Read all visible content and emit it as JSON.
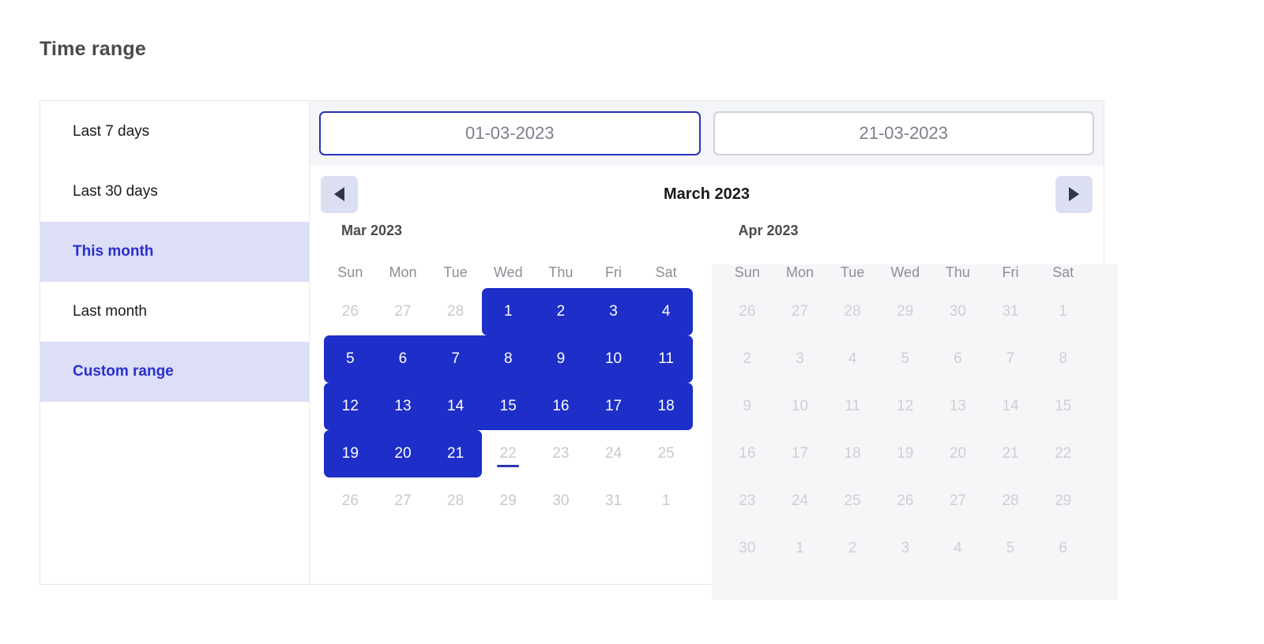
{
  "page": {
    "title": "Time range"
  },
  "sidebar": {
    "presets": [
      {
        "label": "Last 7 days",
        "active": false
      },
      {
        "label": "Last 30 days",
        "active": false
      },
      {
        "label": "This month",
        "active": true
      },
      {
        "label": "Last month",
        "active": false
      },
      {
        "label": "Custom range",
        "active": true
      }
    ]
  },
  "inputs": {
    "start": {
      "value": "01-03-2023",
      "focused": true
    },
    "end": {
      "value": "21-03-2023",
      "focused": false
    }
  },
  "nav": {
    "prev_icon": "triangle-left-icon",
    "next_icon": "triangle-right-icon",
    "title": "March 2023"
  },
  "colors": {
    "selection": "#1d2ec9",
    "accent": "#2a2fd0",
    "highlight_bg": "#dcdff5",
    "nav_btn_bg": "#dcdff2",
    "disabled_panel": "#f6f6f8"
  },
  "weekdays": [
    "Sun",
    "Mon",
    "Tue",
    "Wed",
    "Thu",
    "Fri",
    "Sat"
  ],
  "months": [
    {
      "label": "Mar 2023",
      "disabled": false,
      "weeks": [
        [
          {
            "d": "26",
            "state": "muted"
          },
          {
            "d": "27",
            "state": "muted"
          },
          {
            "d": "28",
            "state": "muted"
          },
          {
            "d": "1",
            "state": "sel",
            "edge": "start"
          },
          {
            "d": "2",
            "state": "sel"
          },
          {
            "d": "3",
            "state": "sel"
          },
          {
            "d": "4",
            "state": "sel",
            "edge": "end"
          }
        ],
        [
          {
            "d": "5",
            "state": "sel",
            "edge": "start"
          },
          {
            "d": "6",
            "state": "sel"
          },
          {
            "d": "7",
            "state": "sel"
          },
          {
            "d": "8",
            "state": "sel"
          },
          {
            "d": "9",
            "state": "sel"
          },
          {
            "d": "10",
            "state": "sel"
          },
          {
            "d": "11",
            "state": "sel",
            "edge": "end"
          }
        ],
        [
          {
            "d": "12",
            "state": "sel",
            "edge": "start"
          },
          {
            "d": "13",
            "state": "sel"
          },
          {
            "d": "14",
            "state": "sel"
          },
          {
            "d": "15",
            "state": "sel"
          },
          {
            "d": "16",
            "state": "sel"
          },
          {
            "d": "17",
            "state": "sel"
          },
          {
            "d": "18",
            "state": "sel",
            "edge": "end"
          }
        ],
        [
          {
            "d": "19",
            "state": "sel",
            "edge": "start"
          },
          {
            "d": "20",
            "state": "sel"
          },
          {
            "d": "21",
            "state": "sel",
            "edge": "end"
          },
          {
            "d": "22",
            "state": "muted",
            "today": true
          },
          {
            "d": "23",
            "state": "muted"
          },
          {
            "d": "24",
            "state": "muted"
          },
          {
            "d": "25",
            "state": "muted"
          }
        ],
        [
          {
            "d": "26",
            "state": "muted"
          },
          {
            "d": "27",
            "state": "muted"
          },
          {
            "d": "28",
            "state": "muted"
          },
          {
            "d": "29",
            "state": "muted"
          },
          {
            "d": "30",
            "state": "muted"
          },
          {
            "d": "31",
            "state": "muted"
          },
          {
            "d": "1",
            "state": "muted"
          }
        ]
      ]
    },
    {
      "label": "Apr 2023",
      "disabled": true,
      "weeks": [
        [
          {
            "d": "26",
            "state": "off"
          },
          {
            "d": "27",
            "state": "off"
          },
          {
            "d": "28",
            "state": "off"
          },
          {
            "d": "29",
            "state": "off"
          },
          {
            "d": "30",
            "state": "off"
          },
          {
            "d": "31",
            "state": "off"
          },
          {
            "d": "1",
            "state": "off"
          }
        ],
        [
          {
            "d": "2",
            "state": "off"
          },
          {
            "d": "3",
            "state": "off"
          },
          {
            "d": "4",
            "state": "off"
          },
          {
            "d": "5",
            "state": "off"
          },
          {
            "d": "6",
            "state": "off"
          },
          {
            "d": "7",
            "state": "off"
          },
          {
            "d": "8",
            "state": "off"
          }
        ],
        [
          {
            "d": "9",
            "state": "off"
          },
          {
            "d": "10",
            "state": "off"
          },
          {
            "d": "11",
            "state": "off"
          },
          {
            "d": "12",
            "state": "off"
          },
          {
            "d": "13",
            "state": "off"
          },
          {
            "d": "14",
            "state": "off"
          },
          {
            "d": "15",
            "state": "off"
          }
        ],
        [
          {
            "d": "16",
            "state": "off"
          },
          {
            "d": "17",
            "state": "off"
          },
          {
            "d": "18",
            "state": "off"
          },
          {
            "d": "19",
            "state": "off"
          },
          {
            "d": "20",
            "state": "off"
          },
          {
            "d": "21",
            "state": "off"
          },
          {
            "d": "22",
            "state": "off"
          }
        ],
        [
          {
            "d": "23",
            "state": "off"
          },
          {
            "d": "24",
            "state": "off"
          },
          {
            "d": "25",
            "state": "off"
          },
          {
            "d": "26",
            "state": "off"
          },
          {
            "d": "27",
            "state": "off"
          },
          {
            "d": "28",
            "state": "off"
          },
          {
            "d": "29",
            "state": "off"
          }
        ],
        [
          {
            "d": "30",
            "state": "off"
          },
          {
            "d": "1",
            "state": "off"
          },
          {
            "d": "2",
            "state": "off"
          },
          {
            "d": "3",
            "state": "off"
          },
          {
            "d": "4",
            "state": "off"
          },
          {
            "d": "5",
            "state": "off"
          },
          {
            "d": "6",
            "state": "off"
          }
        ]
      ]
    }
  ]
}
